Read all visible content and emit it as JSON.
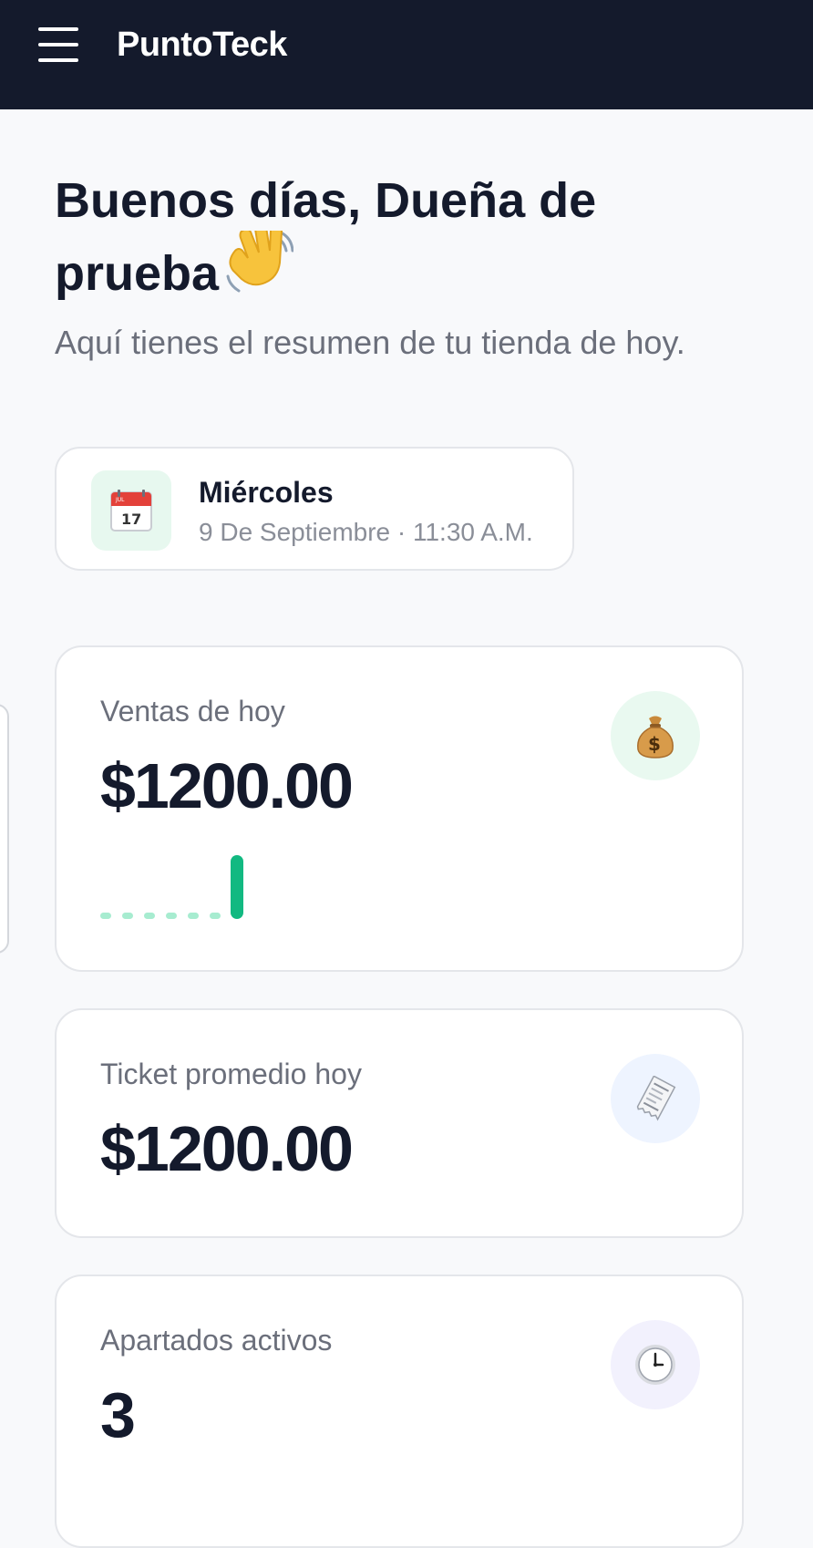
{
  "header": {
    "brand": "PuntoTeck",
    "menu_icon": "hamburger-menu-icon"
  },
  "greeting": {
    "title": "Buenos días, Dueña de prueba",
    "wave_icon": "waving-hand-icon",
    "subtitle": "Aquí tienes el resumen de tu tienda de hoy."
  },
  "date_card": {
    "icon": "calendar-icon",
    "day": "Miércoles",
    "date_time": "9 De Septiembre · 11:30 A.M."
  },
  "stats": [
    {
      "label": "Ventas de hoy",
      "value": "$1200.00",
      "icon": "money-bag-icon",
      "icon_bg": "#e9f9f0",
      "sparkline": [
        0,
        0,
        0,
        0,
        0,
        0,
        1200
      ],
      "sparkline_color": "#12b981",
      "sparkline_dot_color": "#a7ecd0"
    },
    {
      "label": "Ticket promedio hoy",
      "value": "$1200.00",
      "icon": "receipt-icon",
      "icon_bg": "#eef4ff"
    },
    {
      "label": "Apartados activos",
      "value": "3",
      "icon": "clock-icon",
      "icon_bg": "#f2f1fd"
    }
  ],
  "colors": {
    "topbar": "#141a2c",
    "page_bg": "#f8f9fb",
    "text_dark": "#141a2c",
    "text_muted": "#6b6f7b"
  }
}
